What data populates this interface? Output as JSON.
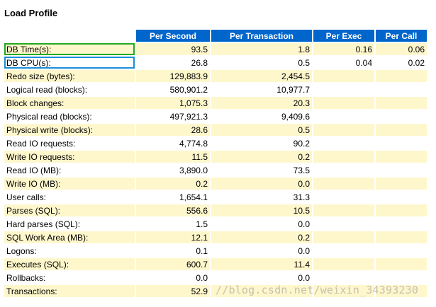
{
  "title": "Load Profile",
  "columns": [
    "Per Second",
    "Per Transaction",
    "Per Exec",
    "Per Call"
  ],
  "rows": [
    {
      "label": "DB Time(s):",
      "per_second": "93.5",
      "per_transaction": "1.8",
      "per_exec": "0.16",
      "per_call": "0.06"
    },
    {
      "label": "DB CPU(s):",
      "per_second": "26.8",
      "per_transaction": "0.5",
      "per_exec": "0.04",
      "per_call": "0.02"
    },
    {
      "label": "Redo size (bytes):",
      "per_second": "129,883.9",
      "per_transaction": "2,454.5",
      "per_exec": "",
      "per_call": ""
    },
    {
      "label": "Logical read (blocks):",
      "per_second": "580,901.2",
      "per_transaction": "10,977.7",
      "per_exec": "",
      "per_call": ""
    },
    {
      "label": "Block changes:",
      "per_second": "1,075.3",
      "per_transaction": "20.3",
      "per_exec": "",
      "per_call": ""
    },
    {
      "label": "Physical read (blocks):",
      "per_second": "497,921.3",
      "per_transaction": "9,409.6",
      "per_exec": "",
      "per_call": ""
    },
    {
      "label": "Physical write (blocks):",
      "per_second": "28.6",
      "per_transaction": "0.5",
      "per_exec": "",
      "per_call": ""
    },
    {
      "label": "Read IO requests:",
      "per_second": "4,774.8",
      "per_transaction": "90.2",
      "per_exec": "",
      "per_call": ""
    },
    {
      "label": "Write IO requests:",
      "per_second": "11.5",
      "per_transaction": "0.2",
      "per_exec": "",
      "per_call": ""
    },
    {
      "label": "Read IO (MB):",
      "per_second": "3,890.0",
      "per_transaction": "73.5",
      "per_exec": "",
      "per_call": ""
    },
    {
      "label": "Write IO (MB):",
      "per_second": "0.2",
      "per_transaction": "0.0",
      "per_exec": "",
      "per_call": ""
    },
    {
      "label": "User calls:",
      "per_second": "1,654.1",
      "per_transaction": "31.3",
      "per_exec": "",
      "per_call": ""
    },
    {
      "label": "Parses (SQL):",
      "per_second": "556.6",
      "per_transaction": "10.5",
      "per_exec": "",
      "per_call": ""
    },
    {
      "label": "Hard parses (SQL):",
      "per_second": "1.5",
      "per_transaction": "0.0",
      "per_exec": "",
      "per_call": ""
    },
    {
      "label": "SQL Work Area (MB):",
      "per_second": "12.1",
      "per_transaction": "0.2",
      "per_exec": "",
      "per_call": ""
    },
    {
      "label": "Logons:",
      "per_second": "0.1",
      "per_transaction": "0.0",
      "per_exec": "",
      "per_call": ""
    },
    {
      "label": "Executes (SQL):",
      "per_second": "600.7",
      "per_transaction": "11.4",
      "per_exec": "",
      "per_call": ""
    },
    {
      "label": "Rollbacks:",
      "per_second": "0.0",
      "per_transaction": "0.0",
      "per_exec": "",
      "per_call": ""
    },
    {
      "label": "Transactions:",
      "per_second": "52.9",
      "per_transaction": "",
      "per_exec": "",
      "per_call": ""
    }
  ],
  "highlights": {
    "green": "DB Time(s):",
    "blue": "DB CPU(s):",
    "green_color": "#22aa22",
    "blue_color": "#1a8fd8"
  },
  "colors": {
    "header_bg": "#0066cc",
    "header_text": "#ffffff",
    "stripe": "#fff7cc"
  },
  "watermark": "//blog.csdn.net/weixin_34393230"
}
